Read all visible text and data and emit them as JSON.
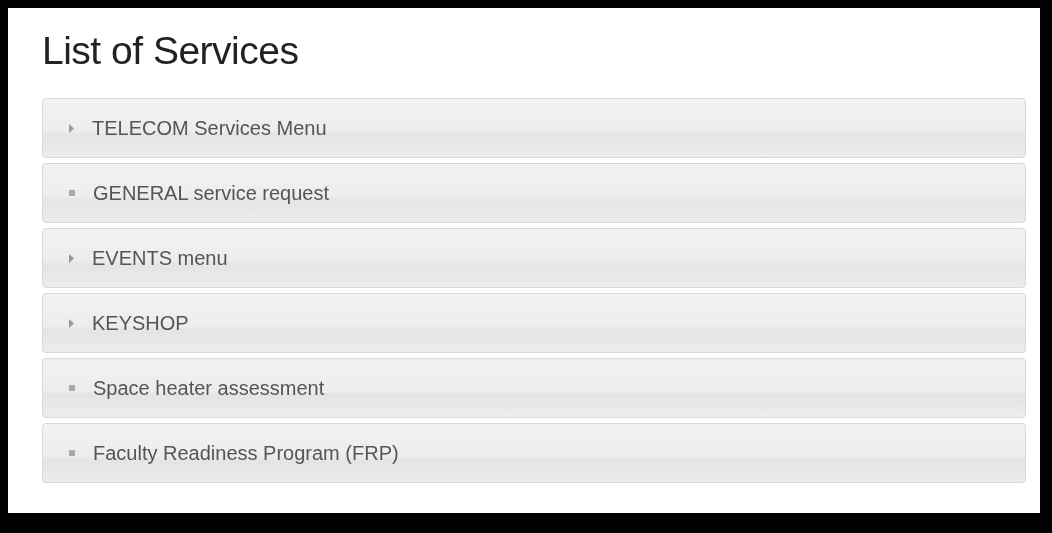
{
  "title": "List of Services",
  "services": [
    {
      "kind": "menu",
      "label": "TELECOM Services Menu"
    },
    {
      "kind": "item",
      "label": "GENERAL service request"
    },
    {
      "kind": "menu",
      "label": "EVENTS menu"
    },
    {
      "kind": "menu",
      "label": "KEYSHOP"
    },
    {
      "kind": "item",
      "label": "Space heater assessment"
    },
    {
      "kind": "item",
      "label": "Faculty Readiness Program (FRP)"
    }
  ]
}
